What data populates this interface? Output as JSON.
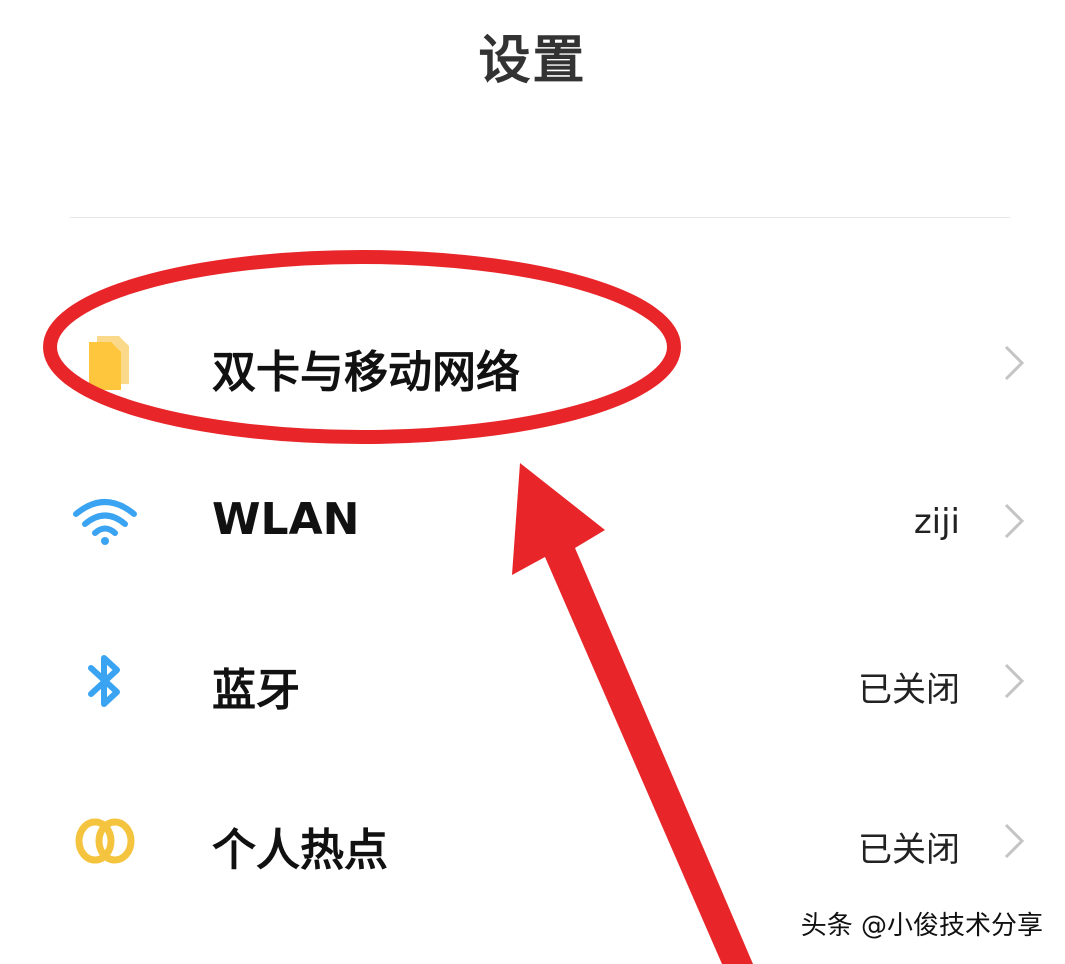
{
  "header": {
    "title": "设置"
  },
  "rows": [
    {
      "label": "双卡与移动网络",
      "value": "",
      "icon": "sim-cards-icon",
      "icon_color": "#FDC63D"
    },
    {
      "label": "WLAN",
      "value": "ziji",
      "icon": "wifi-icon",
      "icon_color": "#3BA4F2"
    },
    {
      "label": "蓝牙",
      "value": "已关闭",
      "icon": "bluetooth-icon",
      "icon_color": "#3BA4F2"
    },
    {
      "label": "个人热点",
      "value": "已关闭",
      "icon": "hotspot-icon",
      "icon_color": "#F5C43E"
    }
  ],
  "annotation": {
    "color": "#E8262A"
  },
  "watermark": "头条 @小俊技术分享"
}
